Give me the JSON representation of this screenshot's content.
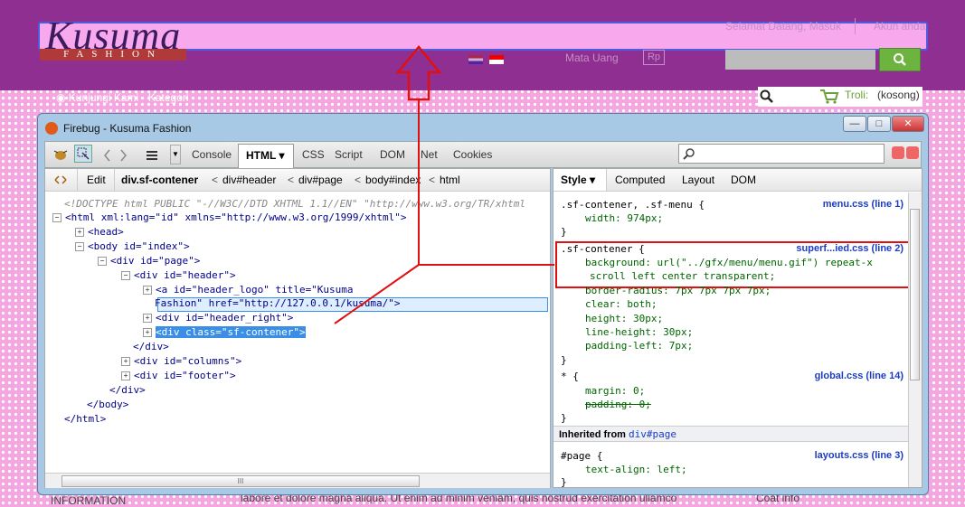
{
  "site": {
    "logo_word": "Kusuma",
    "logo_sub": "FASHION",
    "welcome": "Selamat Datang, Masuk",
    "account": "Akun anda",
    "currency_label": "Mata Uang",
    "currency_value": "Rp",
    "subnav": "◉ Kunjungi Kami · Kategori",
    "cart_label": "Troli:",
    "cart_value": "(kosong)",
    "bottom_left": "INFORMATION",
    "bottom_mid": "labore et dolore magna aliqua. Ut enim ad minim veniam, quis nostrud exercitation ullamco",
    "bottom_right": "Coat info"
  },
  "firebug": {
    "title": "Firebug - Kusuma Fashion",
    "tabs": [
      "Console",
      "HTML ▾",
      "CSS",
      "Script",
      "DOM",
      "Net",
      "Cookies"
    ],
    "edit_label": "Edit",
    "breadcrumb": [
      "div.sf-contener",
      "div#header",
      "div#page",
      "body#index",
      "html"
    ],
    "tree": [
      "<!DOCTYPE html PUBLIC \"-//W3C//DTD XHTML 1.1//EN\" \"http://www.w3.org/TR/xhtml",
      "<html xml:lang=\"id\" xmlns=\"http://www.w3.org/1999/xhtml\">",
      "<head>",
      "<body id=\"index\">",
      "<div id=\"page\">",
      "<div id=\"header\">",
      "<a id=\"header_logo\" title=\"Kusuma",
      "Fashion\" href=\"http://127.0.0.1/kusuma/\">",
      "<div id=\"header_right\">",
      "<div class=\"sf-contener\">",
      "</div>",
      "<div id=\"columns\">",
      "<div id=\"footer\">",
      "</div>",
      "</body>",
      "</html>"
    ],
    "right_tabs": [
      "Style ▾",
      "Computed",
      "Layout",
      "DOM"
    ],
    "rules": [
      {
        "selector": ".sf-contener, .sf-menu {",
        "source": "menu.css (line 1)",
        "props": [
          "width: 974px;"
        ],
        "end": "}"
      },
      {
        "selector": ".sf-contener {",
        "source": "superf...ied.css (line 2)",
        "props": [
          "background: url(\"../gfx/menu/menu.gif\") repeat-x",
          "scroll left center transparent;",
          "border-radius: 7px 7px 7px 7px;",
          "clear: both;",
          "height: 30px;",
          "line-height: 30px;",
          "padding-left: 7px;"
        ],
        "end": "}"
      },
      {
        "selector": "* {",
        "source": "global.css (line 14)",
        "props": [
          "margin: 0;",
          "padding: 0;"
        ],
        "end": "}"
      }
    ],
    "inherited_label": "Inherited from",
    "inherited_from": "div#page",
    "page_rule": {
      "selector": "#page {",
      "source": "layouts.css (line 3)",
      "props": [
        "text-align: left;"
      ],
      "end": "}"
    },
    "hscroll_mark": "III"
  },
  "colors": {
    "header_bg": "#8f2f91",
    "annotation": "#e01010",
    "highlight": "#4e5de0"
  }
}
